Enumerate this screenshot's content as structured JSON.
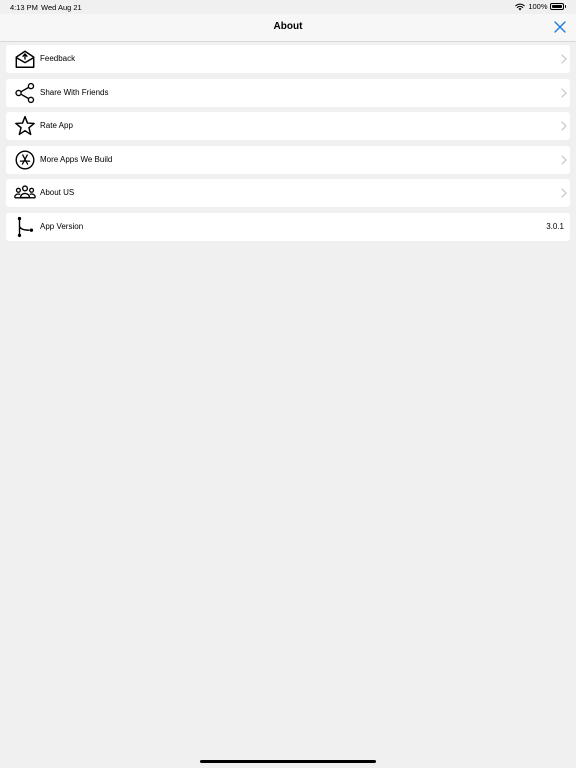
{
  "status_bar": {
    "time": "4:13 PM",
    "date": "Wed Aug 21",
    "battery_percent": "100%",
    "battery_level": 1.0
  },
  "nav": {
    "title": "About",
    "close_icon": "close-icon",
    "accent_color": "#1f7ad6"
  },
  "menu": {
    "items": [
      {
        "label": "Feedback",
        "icon": "envelope-open-icon"
      },
      {
        "label": "Share With Friends",
        "icon": "share-icon"
      },
      {
        "label": "Rate App",
        "icon": "star-icon"
      },
      {
        "label": "More Apps We Build",
        "icon": "app-store-icon"
      },
      {
        "label": "About US",
        "icon": "group-icon"
      }
    ],
    "version": {
      "label": "App Version",
      "value": "3.0.1",
      "icon": "branch-icon"
    }
  }
}
